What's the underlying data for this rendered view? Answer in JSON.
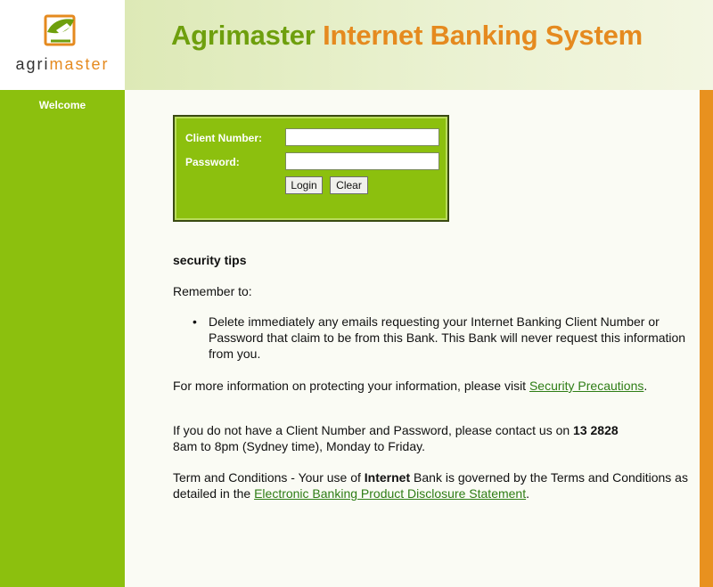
{
  "brand": {
    "logo_word_1": "agri",
    "logo_word_2": "master",
    "title_part_1": "Agrimaster",
    "title_part_2": "Internet Banking System",
    "colors": {
      "green": "#8cc00e",
      "orange": "#e58a1f",
      "dark_green": "#6e9f0d"
    }
  },
  "nav": {
    "welcome": "Welcome"
  },
  "login": {
    "client_label": "Client Number:",
    "password_label": "Password:",
    "client_value": "",
    "password_value": "",
    "login_button": "Login",
    "clear_button": "Clear"
  },
  "content": {
    "heading": "security tips",
    "remember": "Remember to:",
    "tips": [
      "Delete immediately any emails requesting your Internet Banking Client Number or Password that claim to be from this Bank. This Bank will never request this information from you."
    ],
    "more_info_prefix": "For more information on protecting your information, please visit ",
    "more_info_link": "Security Precautions",
    "more_info_suffix": ".",
    "contact_prefix": "If you do not have a Client Number and Password, please contact us on ",
    "contact_phone": "13 2828",
    "contact_suffix": " 8am to 8pm (Sydney time), Monday to Friday.",
    "terms_prefix": "Term and Conditions - Your use of ",
    "terms_bold": "Internet",
    "terms_middle": " Bank is governed by the Terms and Conditions as detailed in the ",
    "terms_link": "Electronic Banking Product Disclosure Statement",
    "terms_suffix": "."
  },
  "icons": {
    "logo": "agrimaster-leaf-logo-icon",
    "bullet": "bullet-icon"
  }
}
